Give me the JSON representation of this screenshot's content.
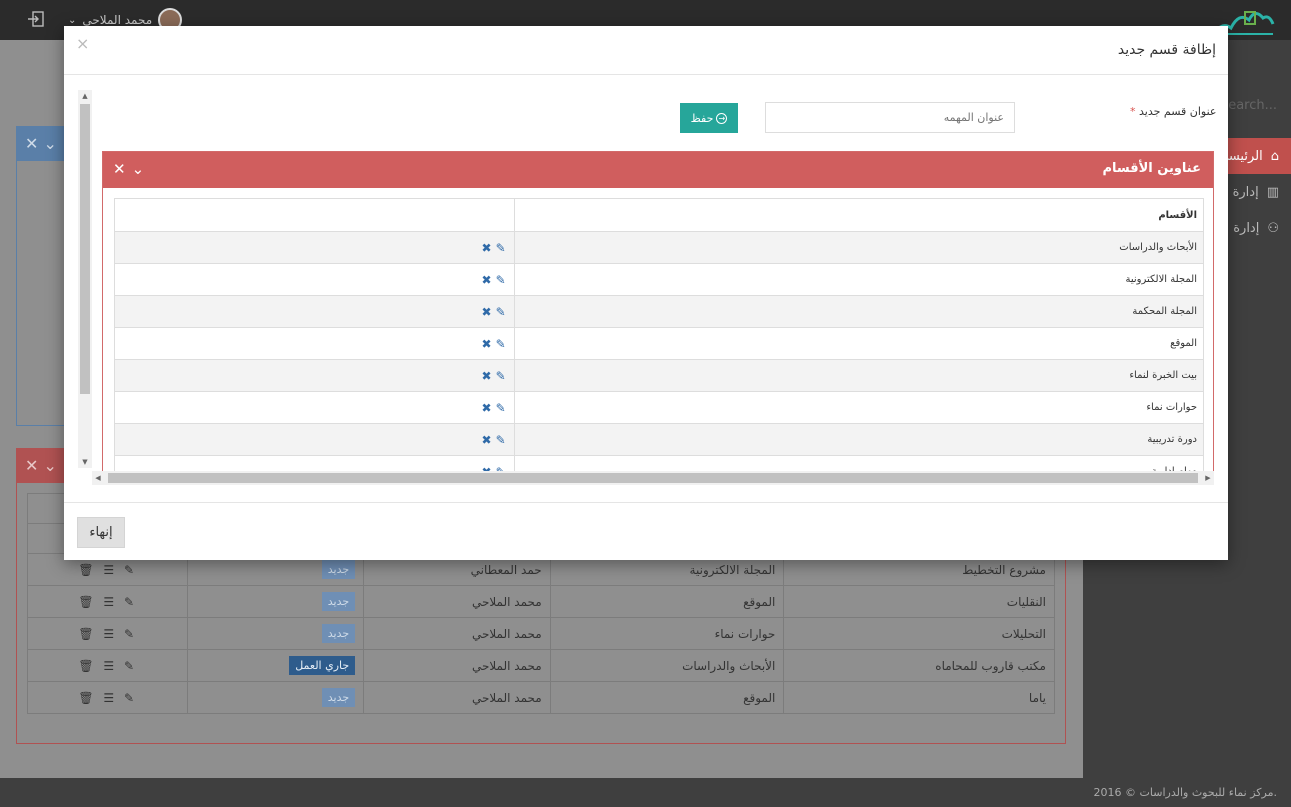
{
  "topbar": {
    "user_name": "محمد الملاحي",
    "chevron": "⌄"
  },
  "sidebar": {
    "search_placeholder": "Search...",
    "items": [
      {
        "label": "الرئيسي",
        "icon": "home-icon"
      },
      {
        "label": "إدارة ا",
        "icon": "chart-icon"
      },
      {
        "label": "إدارة ا",
        "icon": "user-icon"
      }
    ],
    "footer": "2016 © مركز نماء للبحوث والدراسات."
  },
  "background_table": {
    "rows": [
      {
        "name": "مشروع التخطيط",
        "section": "المجلة الالكترونية",
        "user": "حمد المعطاني",
        "status": "جديد",
        "status_type": "new"
      },
      {
        "name": "النقليات",
        "section": "الموقع",
        "user": "محمد الملاحي",
        "status": "جديد",
        "status_type": "new"
      },
      {
        "name": "التحليلات",
        "section": "حوارات نماء",
        "user": "محمد الملاحي",
        "status": "جديد",
        "status_type": "new"
      },
      {
        "name": "مكتب قاروب للمحاماه",
        "section": "الأبحاث والدراسات",
        "user": "محمد الملاحي",
        "status": "جاري العمل",
        "status_type": "work"
      },
      {
        "name": "ياما",
        "section": "الموقع",
        "user": "محمد الملاحي",
        "status": "جديد",
        "status_type": "new"
      }
    ]
  },
  "modal": {
    "title": "إظافة قسم جديد",
    "close": "×",
    "field_label": "عنوان قسم جديد",
    "required_mark": "*",
    "input_placeholder": "عنوان المهمه",
    "save_label": "حفظ",
    "finish_label": "إنهاء",
    "panel": {
      "title": "عناوين الأقسام",
      "column_header": "الأقسام",
      "sections": [
        "الأبحاث والدراسات",
        "المجلة الالكترونية",
        "المجلة المحكمة",
        "الموقع",
        "بيت الخبرة لنماء",
        "حوارات نماء",
        "دورة تدريبية",
        "مهام ادارية"
      ]
    }
  }
}
